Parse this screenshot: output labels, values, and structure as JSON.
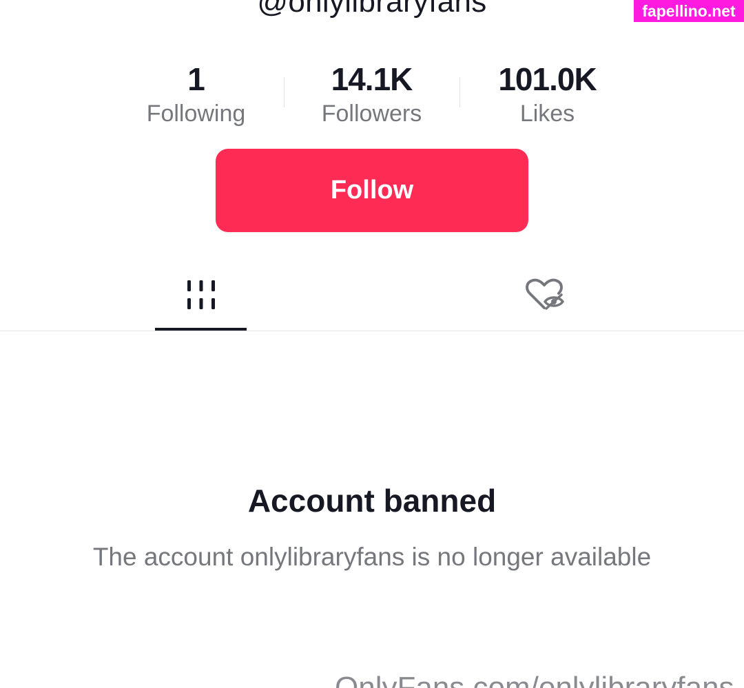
{
  "profile": {
    "username": "@onlylibraryfans"
  },
  "watermark": {
    "text": "fapellino.net",
    "color": "#ff1adf"
  },
  "stats": [
    {
      "value": "1",
      "label": "Following"
    },
    {
      "value": "14.1K",
      "label": "Followers"
    },
    {
      "value": "101.0K",
      "label": "Likes"
    }
  ],
  "follow_button": {
    "label": "Follow",
    "color": "#fe2c55"
  },
  "tabs": [
    {
      "icon": "videos-grid-icon",
      "active": true
    },
    {
      "icon": "liked-hidden-icon",
      "active": false
    }
  ],
  "banned": {
    "title": "Account banned",
    "description": "The account onlylibraryfans is no longer available"
  },
  "footer": {
    "link_text": "OnlyFans.com/onlylibraryfans"
  }
}
